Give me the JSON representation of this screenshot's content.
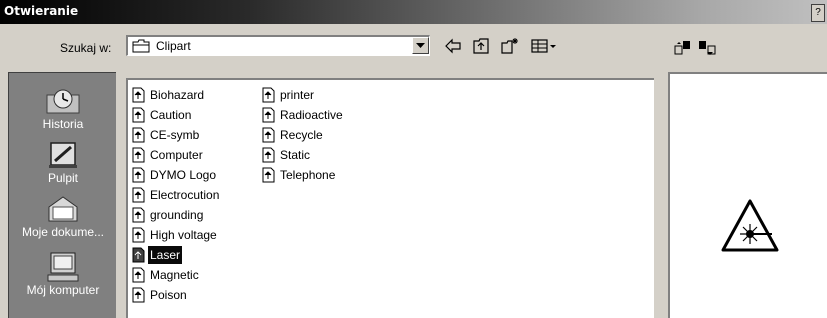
{
  "window": {
    "title": "Otwieranie",
    "help_glyph": "?"
  },
  "lookin": {
    "label": "Szukaj w:",
    "value": "Clipart"
  },
  "toolbar": {
    "buttons": [
      "back-icon",
      "up-folder-icon",
      "new-folder-icon",
      "view-menu-icon"
    ],
    "preview_buttons": [
      "import-icon",
      "export-icon"
    ]
  },
  "places": [
    {
      "label": "Historia",
      "icon": "history-icon"
    },
    {
      "label": "Pulpit",
      "icon": "desktop-icon"
    },
    {
      "label": "Moje dokume...",
      "icon": "my-documents-icon"
    },
    {
      "label": "Mój komputer",
      "icon": "my-computer-icon"
    }
  ],
  "files": {
    "column1": [
      "Biohazard",
      "Caution",
      "CE-symb",
      "Computer",
      "DYMO Logo",
      "Electrocution",
      "grounding",
      "High voltage",
      "Laser",
      "Magnetic",
      "Poison"
    ],
    "column2": [
      "printer",
      "Radioactive",
      "Recycle",
      "Static",
      "Telephone"
    ],
    "selected": "Laser"
  },
  "preview": {
    "icon": "laser-warning-icon"
  },
  "colors": {
    "selection": "#0a0a0a",
    "warning_border": "#000000"
  }
}
